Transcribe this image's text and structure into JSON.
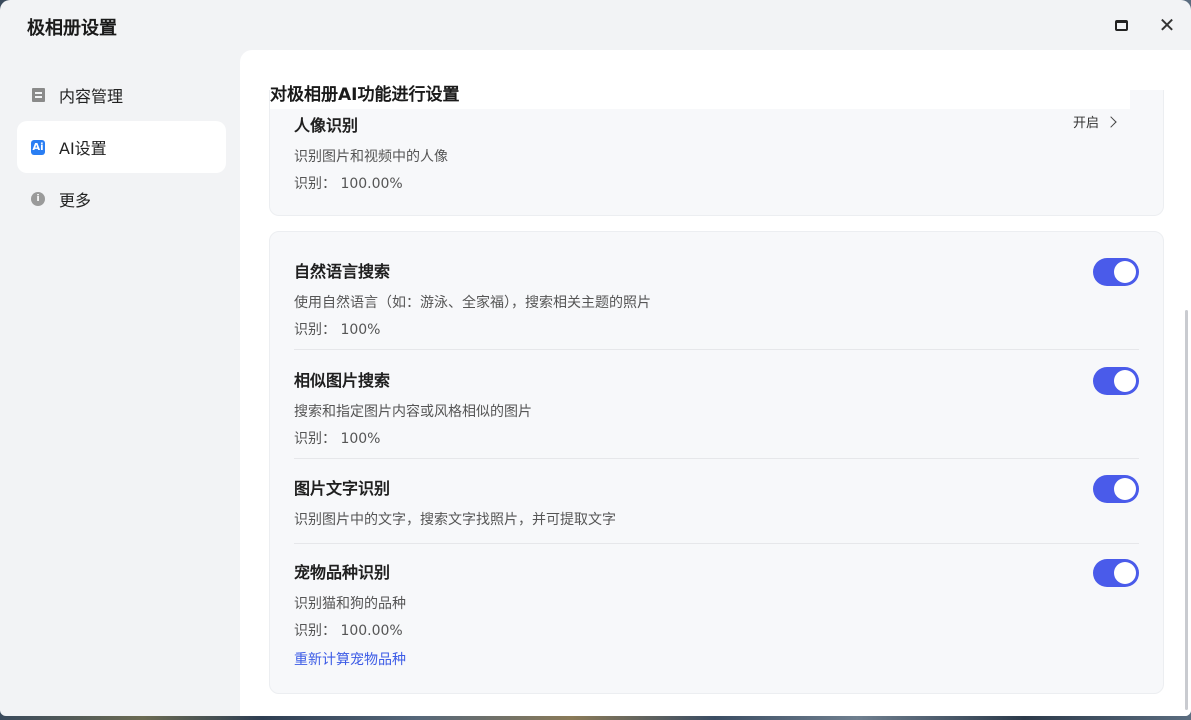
{
  "window": {
    "title": "极相册设置",
    "close_glyph": "✕"
  },
  "sidebar": {
    "items": [
      {
        "label": "内容管理",
        "icon": "document-icon"
      },
      {
        "label": "AI设置",
        "icon": "ai-icon",
        "icon_text": "Ai",
        "active": true
      },
      {
        "label": "更多",
        "icon": "info-icon"
      }
    ]
  },
  "main": {
    "heading": "对极相册AI功能进行设置",
    "portrait": {
      "title": "人像识别",
      "desc": "识别图片和视频中的人像",
      "stat": "识别： 100.00%",
      "action": "开启"
    },
    "features": [
      {
        "title": "自然语言搜索",
        "desc": "使用自然语言（如：游泳、全家福），搜索相关主题的照片",
        "stat": "识别： 100%",
        "enabled": true
      },
      {
        "title": "相似图片搜索",
        "desc": "搜索和指定图片内容或风格相似的图片",
        "stat": "识别： 100%",
        "enabled": true
      },
      {
        "title": "图片文字识别",
        "desc": "识别图片中的文字，搜索文字找照片，并可提取文字",
        "enabled": true
      },
      {
        "title": "宠物品种识别",
        "desc": "识别猫和狗的品种",
        "stat": "识别： 100.00%",
        "link": "重新计算宠物品种",
        "enabled": true
      }
    ]
  },
  "colors": {
    "accent": "#4a5bea",
    "link": "#3d5ce6",
    "ai_icon": "#2a7ef3"
  }
}
